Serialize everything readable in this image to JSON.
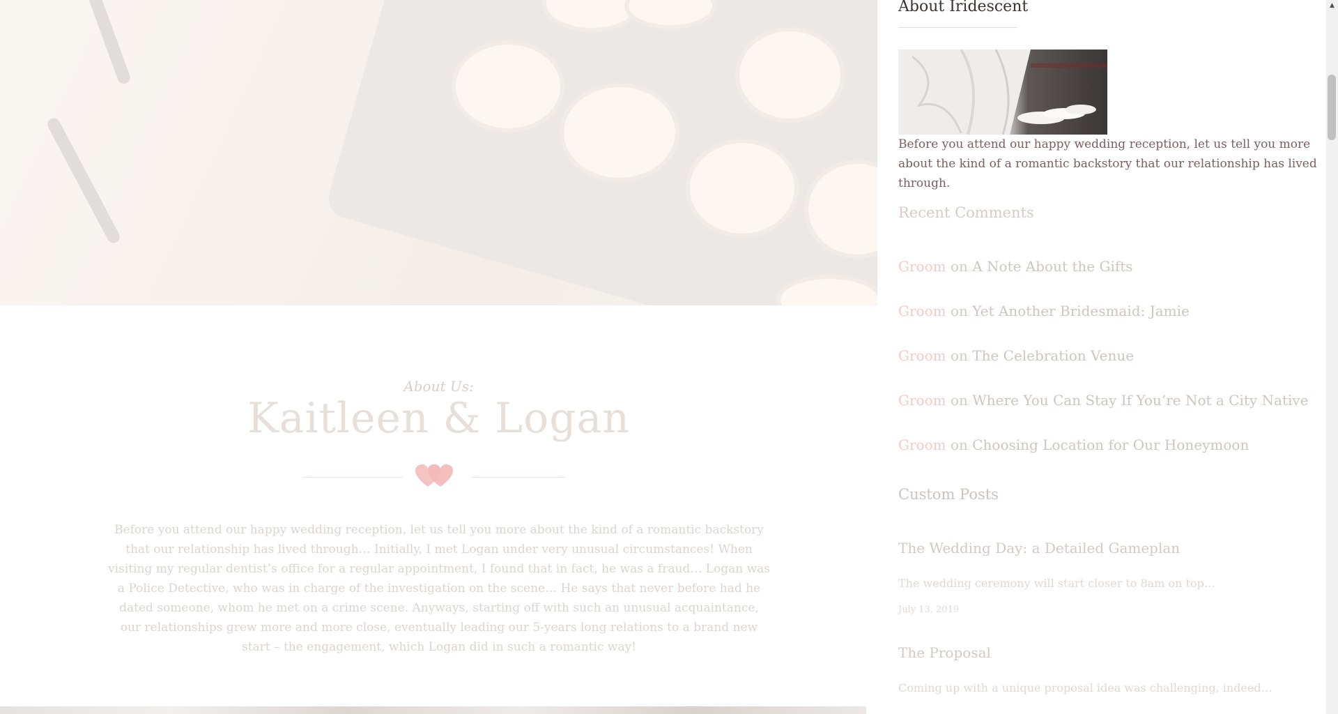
{
  "about_us": {
    "kicker": "About Us:",
    "title": "Kaitleen & Logan",
    "body": "Before you attend our happy wedding reception, let us tell you more about the kind of a romantic backstory that our relationship has lived through… Initially, I met Logan under very unusual circumstances! When visiting my regular dentist’s office for a regular appointment, I found that in fact, he was a fraud… Logan was a Police Detective, who was in charge of the investigation on the scene… He says that never before had he dated someone, whom he met on a crime scene. Anyways, starting off with such an unusual acquaintance, our relationships grew more and more close, eventually leading our 5-years long relations to a brand new start – the engagement, which Logan did in such a romantic way!"
  },
  "sidebar": {
    "about_widget": {
      "title": "About Iridescent",
      "text": "Before you attend our happy wedding reception, let us tell you more about the kind of a romantic backstory that our relationship has lived through."
    },
    "recent_comments": {
      "title": "Recent Comments",
      "on_word": "on",
      "items": [
        {
          "author": "Groom",
          "post": "A Note About the Gifts"
        },
        {
          "author": "Groom",
          "post": "Yet Another Bridesmaid: Jamie"
        },
        {
          "author": "Groom",
          "post": "The Celebration Venue"
        },
        {
          "author": "Groom",
          "post": "Where You Can Stay If You’re Not a City Native"
        },
        {
          "author": "Groom",
          "post": "Choosing Location for Our Honeymoon"
        }
      ]
    },
    "custom_posts": {
      "title": "Custom Posts",
      "items": [
        {
          "title": "The Wedding Day: a Detailed Gameplan",
          "excerpt": "The wedding ceremony will start closer to 8am on top…",
          "date": "July 13, 2019"
        },
        {
          "title": "The Proposal",
          "excerpt": "Coming up with a unique proposal idea was challenging, indeed…",
          "date": ""
        }
      ]
    }
  },
  "colors": {
    "accent_pink": "#f4c9c9",
    "heart_pink": "#f6c3c3",
    "text_dark": "#3c3330",
    "text_about": "#7a5f5f"
  },
  "icons": [
    "heart-divider-icon",
    "scroll-up-arrow-icon"
  ]
}
